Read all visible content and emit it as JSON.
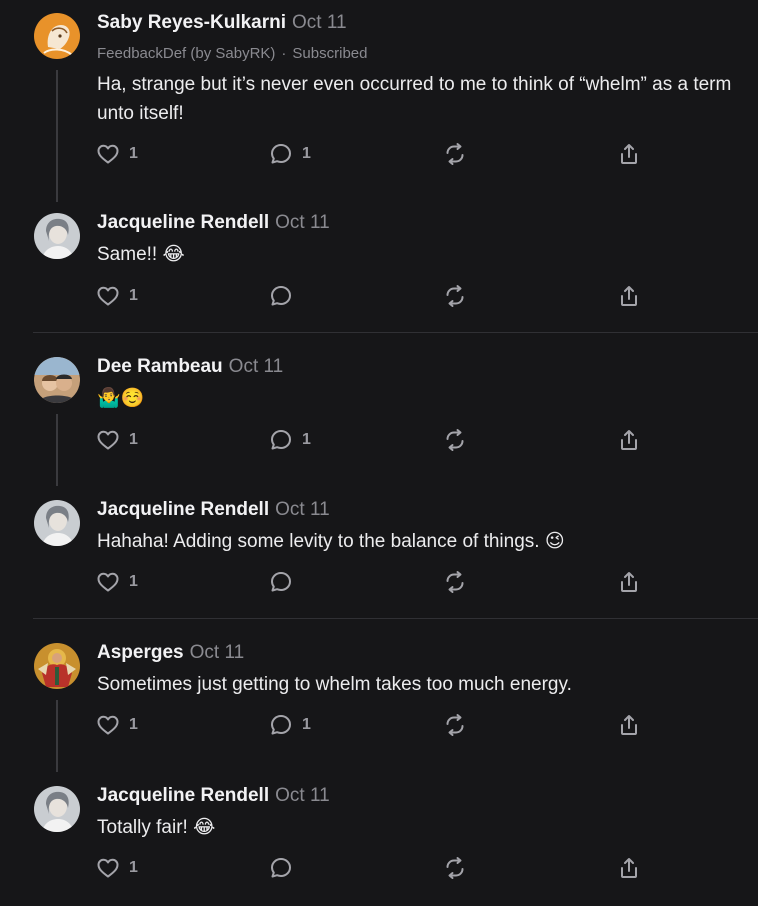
{
  "comments": [
    {
      "author": "Saby Reyes-Kulkarni",
      "date": "Oct 11",
      "publication": "FeedbackDef (by SabyRK)",
      "separator": "·",
      "status": "Subscribed",
      "text": "Ha, strange but it’s never even occurred to me to think of “whelm” as a term unto itself!",
      "emoji": "",
      "likes": "1",
      "replies": "1",
      "avatar_icon": "illustrated-face-avatar",
      "avatar_color": "#e8922a"
    },
    {
      "author": "Jacqueline Rendell",
      "date": "Oct 11",
      "text": "Same!!",
      "emoji": "😂",
      "likes": "1",
      "replies": "",
      "avatar_icon": "photo-avatar",
      "avatar_color": "#9aa3ac"
    },
    {
      "author": "Dee Rambeau",
      "date": "Oct 11",
      "text": "",
      "emoji": "🤷‍♂️☺️",
      "likes": "1",
      "replies": "1",
      "avatar_icon": "photo-avatar",
      "avatar_color": "#b0885f"
    },
    {
      "author": "Jacqueline Rendell",
      "date": "Oct 11",
      "text": "Hahaha! Adding some levity to the balance of things.",
      "emoji": "😉",
      "likes": "1",
      "replies": "",
      "avatar_icon": "photo-avatar",
      "avatar_color": "#9aa3ac"
    },
    {
      "author": "Asperges",
      "date": "Oct 11",
      "text": "Sometimes just getting to whelm takes too much energy.",
      "emoji": "",
      "likes": "1",
      "replies": "1",
      "avatar_icon": "icon-painting-avatar",
      "avatar_color": "#c8902e"
    },
    {
      "author": "Jacqueline Rendell",
      "date": "Oct 11",
      "text": "Totally fair!",
      "emoji": "😂",
      "likes": "1",
      "replies": "",
      "avatar_icon": "photo-avatar",
      "avatar_color": "#9aa3ac"
    }
  ],
  "action_icons": [
    "heart-icon",
    "comment-icon",
    "restack-icon",
    "share-icon"
  ],
  "colors": {
    "background": "#161618",
    "text": "#ececee",
    "muted": "#8a8a90",
    "divider": "#303034"
  }
}
